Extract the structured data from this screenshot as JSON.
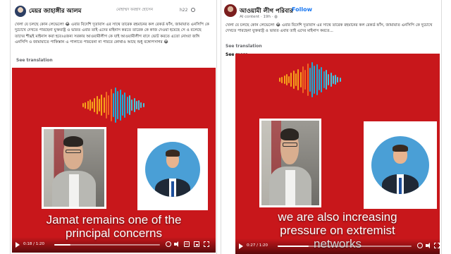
{
  "colors": {
    "video_background": "#c8171b",
    "link_blue": "#1877f2",
    "muted_text": "#65676b",
    "wave_colors": [
      "#f7a21b",
      "#f26522",
      "#1fa9d6",
      "#43c6e0"
    ]
  },
  "left_post": {
    "author": "মেয়র জাহাঙ্গীর আলম",
    "shared_by": "মোহাম্মদ ফরহাদ হোসেন",
    "time": "h22",
    "caption": "খেলা যে চলছে কোন লেভেলে! 😂 এবার বিদেশি দূতাবাস এর সাথে তারেক রহমানের কল রেকর্ড ফাঁস, জামায়াত এনসিপি কে দুচোখে দেখতে পারছেনা যুক্তরাষ্ট্র ও ভারত এবার তাই এদের মাইনাস করতে তারেক কে কাজ দেওয়া হয়েছে সে ও বলেছে তাদের শীঘ্রই মাইনাস করা হবে।এজন্য সরকার আওয়ামীলীগ কে যাই আওয়ামীলীগ বাদে ভোট করতে এতো নোংরা জঙ্গি এনসিপি ও জামায়াতে পাকিস্তান এ পালাতে পারবেনা না পারবে কোথাও আছে শুধু বঙ্গোপসাগর 😂",
    "see_translation": "See translation",
    "video": {
      "subtitle_lines": [
        "Jamat remains one of the",
        "principal concerns"
      ],
      "time": "0:18 / 1:20",
      "progress": 0.15
    }
  },
  "right_post": {
    "author": "আওয়ামী লীগ পরিবার",
    "follow": "Follow",
    "ai_content": "AI content",
    "time": "19h",
    "caption": "খেলা যে চলছে কোন লেভেলে! 😂 এবার বিদেশি দূতাবাস এর সাথে তারেক রহমানের কল রেকর্ড ফাঁস, জামায়াত এনসিপি কে দুচোখে দেখতে পারছেনা যুক্তরাষ্ট্র ও ভারত এবার তাই এদের মাইনাস করতে...",
    "see_translation": "See translation",
    "see_more": "See more",
    "video": {
      "subtitle_lines": [
        "we are also increasing",
        "pressure on extremist",
        "networks"
      ],
      "time": "0:27 / 1:20",
      "progress": 0.23
    }
  }
}
